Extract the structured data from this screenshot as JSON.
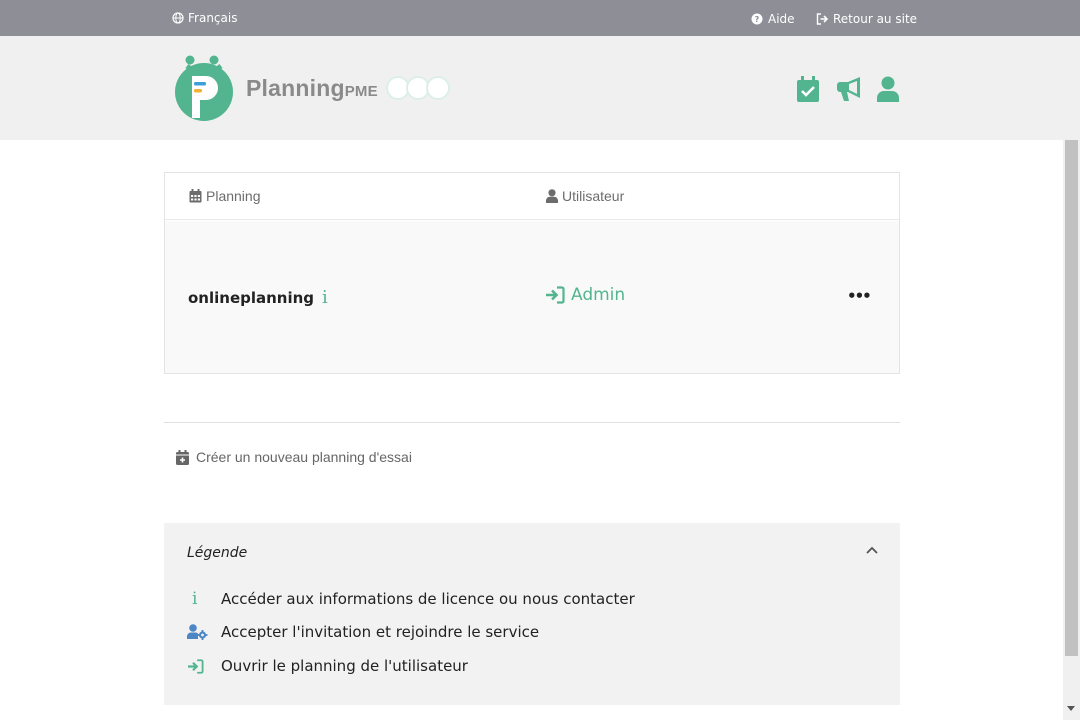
{
  "topbar": {
    "language": "Français",
    "help": "Aide",
    "back_to_site": "Retour au site"
  },
  "logo": {
    "name_main": "Planning",
    "name_suffix": "PME"
  },
  "header_icons": [
    "calendar-check-icon",
    "megaphone-icon",
    "user-icon"
  ],
  "table": {
    "col_planning": "Planning",
    "col_user": "Utilisateur",
    "row": {
      "planning": "onlineplanning",
      "user": "Admin",
      "more": "•••"
    }
  },
  "create_trial": "Créer un nouveau planning d'essai",
  "legend": {
    "title": "Légende",
    "items": [
      {
        "icon": "info-icon",
        "text": "Accéder aux informations de licence ou nous contacter"
      },
      {
        "icon": "user-cog-icon",
        "text": "Accepter l'invitation et rejoindre le service"
      },
      {
        "icon": "sign-in-icon",
        "text": "Ouvrir le planning de l'utilisateur"
      }
    ]
  },
  "colors": {
    "accent": "#52b58f",
    "topbar": "#8d8e96",
    "header_bg": "#f0f0f0",
    "user_cog_blue": "#4d86c4"
  }
}
